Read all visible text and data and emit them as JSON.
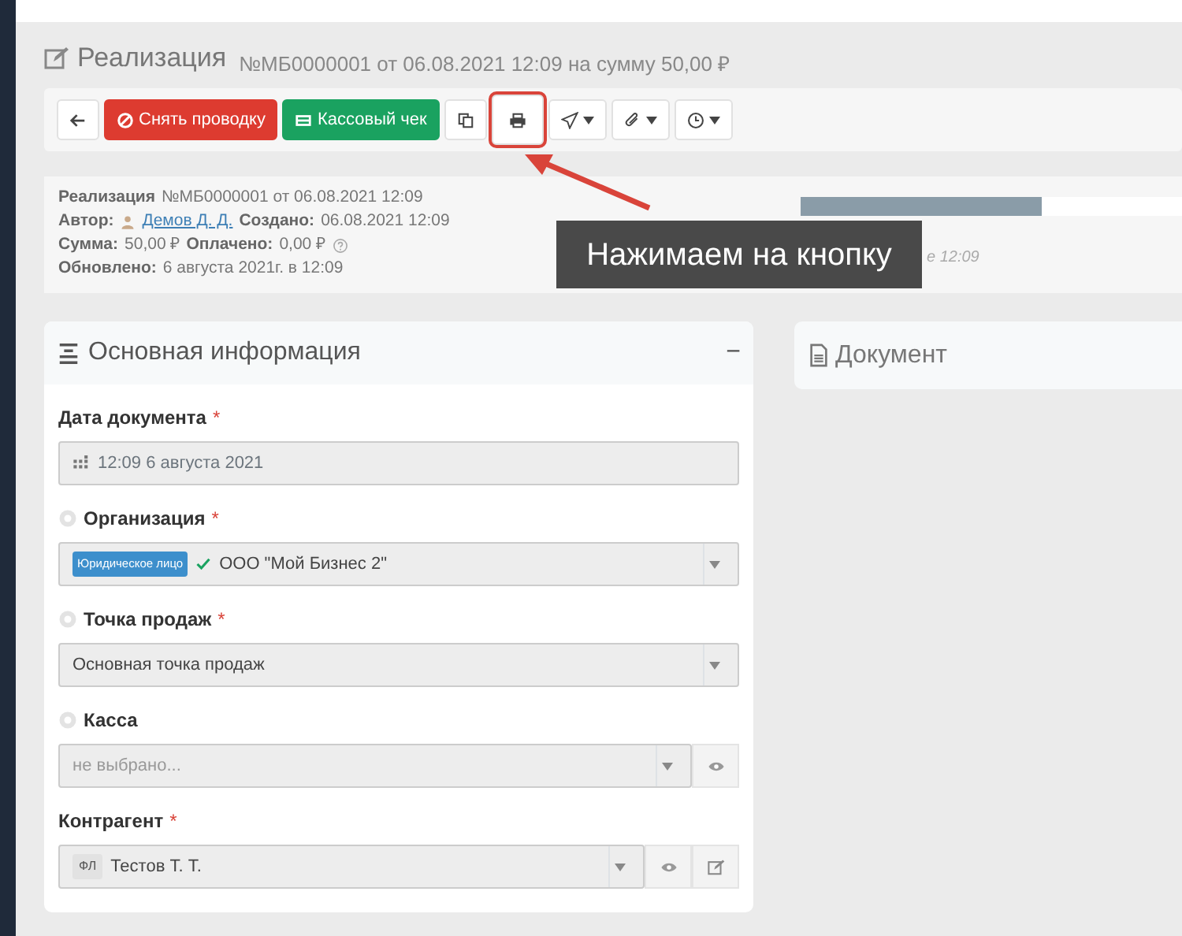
{
  "header": {
    "title": "Реализация",
    "subtitle": "№МБ0000001 от 06.08.2021 12:09 на сумму 50,00 ₽"
  },
  "toolbar": [
    {
      "kind": "back",
      "highlighted": false
    },
    {
      "kind": "unpost",
      "label": "Снять проводку",
      "highlighted": false
    },
    {
      "kind": "receipt",
      "label": "Кассовый чек",
      "highlighted": false
    },
    {
      "kind": "copy",
      "highlighted": false
    },
    {
      "kind": "print",
      "highlighted": true
    },
    {
      "kind": "send",
      "highlighted": false
    },
    {
      "kind": "attach",
      "highlighted": false
    },
    {
      "kind": "history",
      "highlighted": false
    }
  ],
  "info": {
    "lines": [
      [
        {
          "label": "Реализация",
          "value": "№МБ0000001 от 06.08.2021 12:09"
        }
      ],
      [
        {
          "label": "Автор:",
          "value": "Демов Д. Д.",
          "link": true
        },
        {
          "label": "Создано:",
          "value": "06.08.2021 12:09"
        }
      ],
      [
        {
          "label": "Сумма:",
          "value": "50,00 ₽"
        },
        {
          "label": "Оплачено:",
          "value": "0,00 ₽",
          "help": true
        }
      ],
      [
        {
          "label": "Обновлено:",
          "value": "6 августа 2021г. в 12:09"
        }
      ]
    ],
    "progress": {
      "level": 0.61
    },
    "status_fragment": "е 12:09"
  },
  "annotation": {
    "text": "Нажимаем на кнопку"
  },
  "main_card": {
    "title": "Основная информация",
    "collapse": "−",
    "fields": [
      {
        "kind": "date",
        "label": "Дата документа",
        "required_mark": "*",
        "help": false,
        "value": "12:09 6 августа 2021"
      },
      {
        "kind": "select",
        "label": "Организация",
        "required_mark": "*",
        "help": true,
        "tag": "Юридическое лицо",
        "verified": true,
        "value": "ООО \"Мой Бизнес 2\"",
        "view_button": false,
        "edit_button": false
      },
      {
        "kind": "select",
        "label": "Точка продаж",
        "required_mark": "*",
        "help": true,
        "value": "Основная точка продаж",
        "view_button": false,
        "edit_button": false
      },
      {
        "kind": "select",
        "label": "Касса",
        "help": true,
        "placeholder": "не выбрано...",
        "view_button": true,
        "edit_button": false
      },
      {
        "kind": "select",
        "label": "Контрагент",
        "required_mark": "*",
        "help": false,
        "tag": "ФЛ",
        "value": "Тестов Т. Т.",
        "view_button": true,
        "edit_button": true
      }
    ]
  },
  "side_card": {
    "title": "Документ"
  }
}
